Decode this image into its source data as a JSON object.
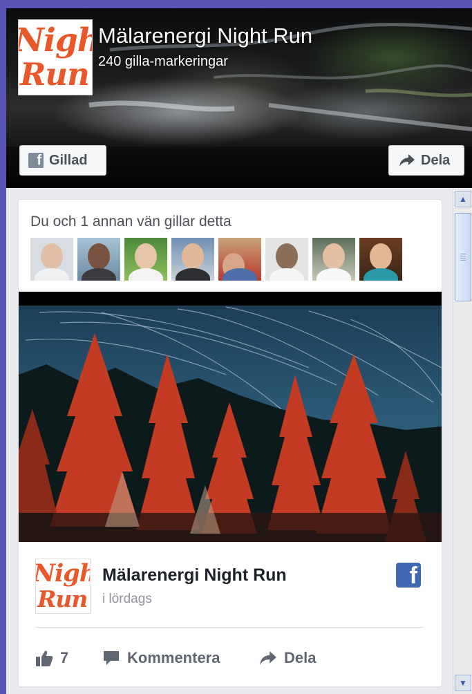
{
  "page": {
    "title": "Mälarenergi Night Run",
    "likes_text": "240 gilla-markeringar",
    "logo_line1": "Night",
    "logo_line2": "Run",
    "liked_label": "Gillad",
    "share_label": "Dela"
  },
  "post": {
    "friends_text": "Du och 1 annan vän gillar detta",
    "author": "Mälarenergi Night Run",
    "time": "i lördags",
    "like_count": "7",
    "comment_label": "Kommentera",
    "share_label": "Dela"
  },
  "icons": {
    "liked": "facebook-f-icon",
    "share": "share-arrow-icon",
    "like": "thumbs-up-icon",
    "comment": "speech-bubble-icon",
    "brand": "facebook-logo-icon"
  },
  "colors": {
    "frame": "#5a56b8",
    "feed_background": "#e9ebee",
    "logo_orange": "#e8582a",
    "facebook_blue": "#4267b2"
  }
}
